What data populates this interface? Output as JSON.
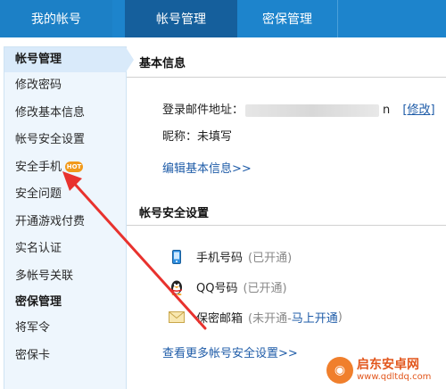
{
  "topnav": {
    "tabs": [
      {
        "label": "我的帐号"
      },
      {
        "label": "帐号管理"
      },
      {
        "label": "密保管理"
      }
    ]
  },
  "sidebar": {
    "section1": "帐号管理",
    "items1": [
      {
        "label": "修改密码"
      },
      {
        "label": "修改基本信息"
      },
      {
        "label": "帐号安全设置"
      },
      {
        "label": "安全手机",
        "badge": "HOT"
      },
      {
        "label": "安全问题"
      },
      {
        "label": "开通游戏付费"
      },
      {
        "label": "实名认证"
      },
      {
        "label": "多帐号关联"
      }
    ],
    "section2": "密保管理",
    "items2": [
      {
        "label": "将军令"
      },
      {
        "label": "密保卡"
      }
    ]
  },
  "basic": {
    "title": "基本信息",
    "email_label": "登录邮件地址：",
    "email_tail": "n",
    "modify": "[修改]",
    "nickname": "昵称：未填写",
    "edit_link": "编辑基本信息>>"
  },
  "security": {
    "title": "帐号安全设置",
    "rows": [
      {
        "label": "手机号码",
        "status": "(已开通)",
        "icon": "mobile-phone-icon"
      },
      {
        "label": "QQ号码",
        "status": "(已开通)",
        "icon": "qq-penguin-icon"
      },
      {
        "label": "保密邮箱",
        "status_prefix": "(未开通-",
        "status_link": "马上开通",
        "status_suffix": ")",
        "icon": "envelope-icon"
      }
    ],
    "more_link": "查看更多帐号安全设置>>"
  },
  "watermark": {
    "title": "启东安卓网",
    "url": "www.qdltdq.com"
  },
  "colors": {
    "nav_blue": "#1d84cc",
    "nav_active": "#155f9c",
    "arrow_red": "#e8322e",
    "link_blue": "#1f5ca8"
  }
}
